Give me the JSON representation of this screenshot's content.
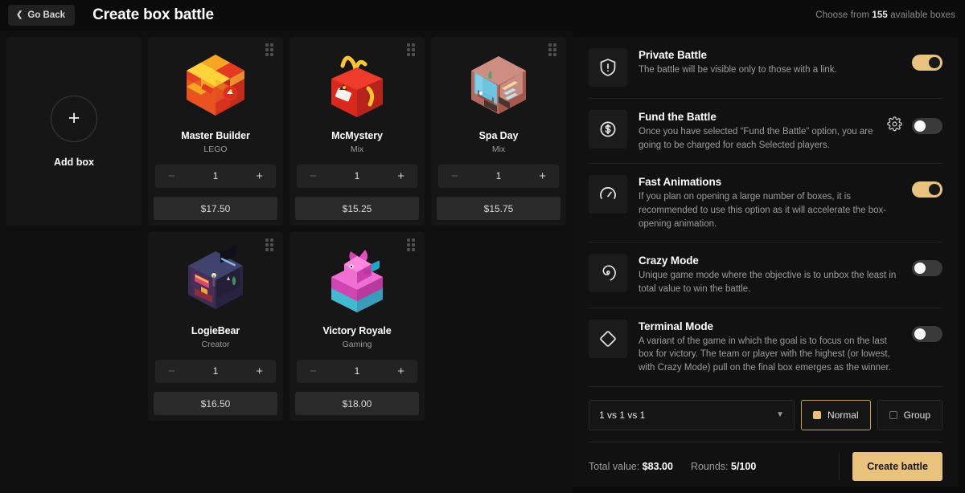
{
  "header": {
    "back_label": "Go Back",
    "title": "Create box battle",
    "available_prefix": "Choose from ",
    "available_count": "155",
    "available_suffix": " available boxes"
  },
  "boxes_panel": {
    "add_box_label": "Add box",
    "add_icon": "plus-icon",
    "minus_label": "−",
    "plus_label": "+",
    "items": [
      {
        "name": "Master Builder",
        "brand": "LEGO",
        "qty": "1",
        "price": "$17.50",
        "art": "lego"
      },
      {
        "name": "McMystery",
        "brand": "Mix",
        "qty": "1",
        "price": "$15.25",
        "art": "mcd"
      },
      {
        "name": "Spa Day",
        "brand": "Mix",
        "qty": "1",
        "price": "$15.75",
        "art": "spa"
      },
      {
        "name": "LogieBear",
        "brand": "Creator",
        "qty": "1",
        "price": "$16.50",
        "art": "room"
      },
      {
        "name": "Victory Royale",
        "brand": "Gaming",
        "qty": "1",
        "price": "$18.00",
        "art": "llama"
      }
    ]
  },
  "settings": [
    {
      "id": "private-battle",
      "icon": "shield-alert-icon",
      "title": "Private Battle",
      "desc": "The battle will be visible only to those with a link.",
      "toggle_on": true,
      "has_gear": false
    },
    {
      "id": "fund-the-battle",
      "icon": "dollar-circle-icon",
      "title": "Fund the Battle",
      "desc": "Once you have selected “Fund the Battle” option, you are going to be charged for each Selected players.",
      "toggle_on": false,
      "has_gear": true,
      "gear_icon": "gear-icon"
    },
    {
      "id": "fast-animations",
      "icon": "speedometer-icon",
      "title": "Fast Animations",
      "desc": "If you plan on opening a large number of boxes, it is recommended to use this option as it will accelerate the box-opening animation.",
      "toggle_on": true,
      "has_gear": false
    },
    {
      "id": "crazy-mode",
      "icon": "spiral-icon",
      "title": "Crazy Mode",
      "desc": "Unique game mode where the objective is to unbox the least in total value to win the battle.",
      "toggle_on": false,
      "has_gear": false
    },
    {
      "id": "terminal-mode",
      "icon": "diamond-icon",
      "title": "Terminal Mode",
      "desc": "A variant of the game in which the goal is to focus on the last box for victory. The team or player with the highest (or lowest, with Crazy Mode) pull on the final box emerges as the winner.",
      "toggle_on": false,
      "has_gear": false
    }
  ],
  "mode_row": {
    "players_selected": "1 vs 1 vs 1",
    "chevron_icon": "chevron-down-icon",
    "normal_label": "Normal",
    "group_label": "Group",
    "normal_selected": true
  },
  "footer": {
    "total_label": "Total value:",
    "total_value": "$83.00",
    "rounds_label": "Rounds:",
    "rounds_value": "5/100",
    "create_label": "Create battle"
  },
  "colors": {
    "accent": "#E9C37D",
    "page_bg": "#0B0B0B",
    "card_bg": "#161616",
    "panel_bg": "#111111"
  }
}
